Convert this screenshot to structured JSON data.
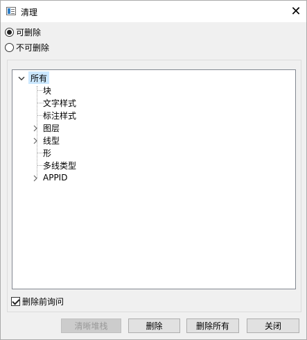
{
  "window": {
    "title": "清理",
    "close_glyph": "✕"
  },
  "options": {
    "purgeable": {
      "label": "可删除",
      "checked": true
    },
    "non_purgeable": {
      "label": "不可删除",
      "checked": false
    }
  },
  "tree": {
    "root": {
      "label": "所有",
      "expanded": true
    },
    "items": [
      {
        "label": "块",
        "expandable": false
      },
      {
        "label": "文字样式",
        "expandable": false
      },
      {
        "label": "标注样式",
        "expandable": false
      },
      {
        "label": "图层",
        "expandable": true
      },
      {
        "label": "线型",
        "expandable": true
      },
      {
        "label": "形",
        "expandable": false
      },
      {
        "label": "多线类型",
        "expandable": false
      },
      {
        "label": "APPID",
        "expandable": true
      }
    ]
  },
  "confirm": {
    "label": "删除前询问",
    "checked": true
  },
  "buttons": {
    "clear_stack": {
      "label": "清晰堆栈",
      "enabled": false
    },
    "purge": {
      "label": "删除",
      "enabled": true
    },
    "purge_all": {
      "label": "删除所有",
      "enabled": true
    },
    "close": {
      "label": "关闭",
      "enabled": true
    }
  }
}
